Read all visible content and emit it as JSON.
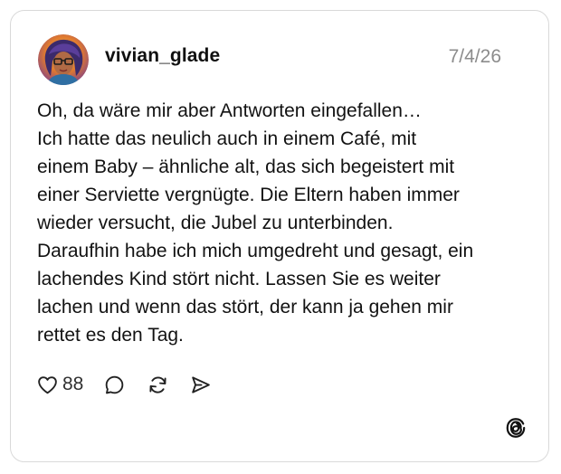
{
  "post": {
    "username": "vivian_glade",
    "date": "7/4/26",
    "text_lines": [
      "Oh, da wäre mir aber Antworten eingefallen…",
      "Ich hatte das neulich auch in einem Café, mit",
      "einem Baby – ähnliche alt, das sich begeistert mit",
      "einer Serviette vergnügte. Die Eltern haben immer",
      "wieder versucht, die Jubel zu unterbinden.",
      "Daraufhin habe ich mich umgedreht und gesagt, ein",
      "lachendes Kind stört nicht. Lassen Sie es weiter",
      "lachen und wenn das stört, der kann ja gehen mir",
      "rettet es den Tag."
    ],
    "like_count": "88"
  },
  "icons": {
    "avatar": "avatar-image",
    "like": "heart-icon",
    "reply": "comment-icon",
    "repost": "repost-icon",
    "share": "send-icon",
    "brand": "threads-logo-icon"
  },
  "colors": {
    "text": "#101010",
    "muted": "#8c8c8c",
    "border": "#d9d9d9",
    "avatar_ring": "#e8e8e8"
  }
}
